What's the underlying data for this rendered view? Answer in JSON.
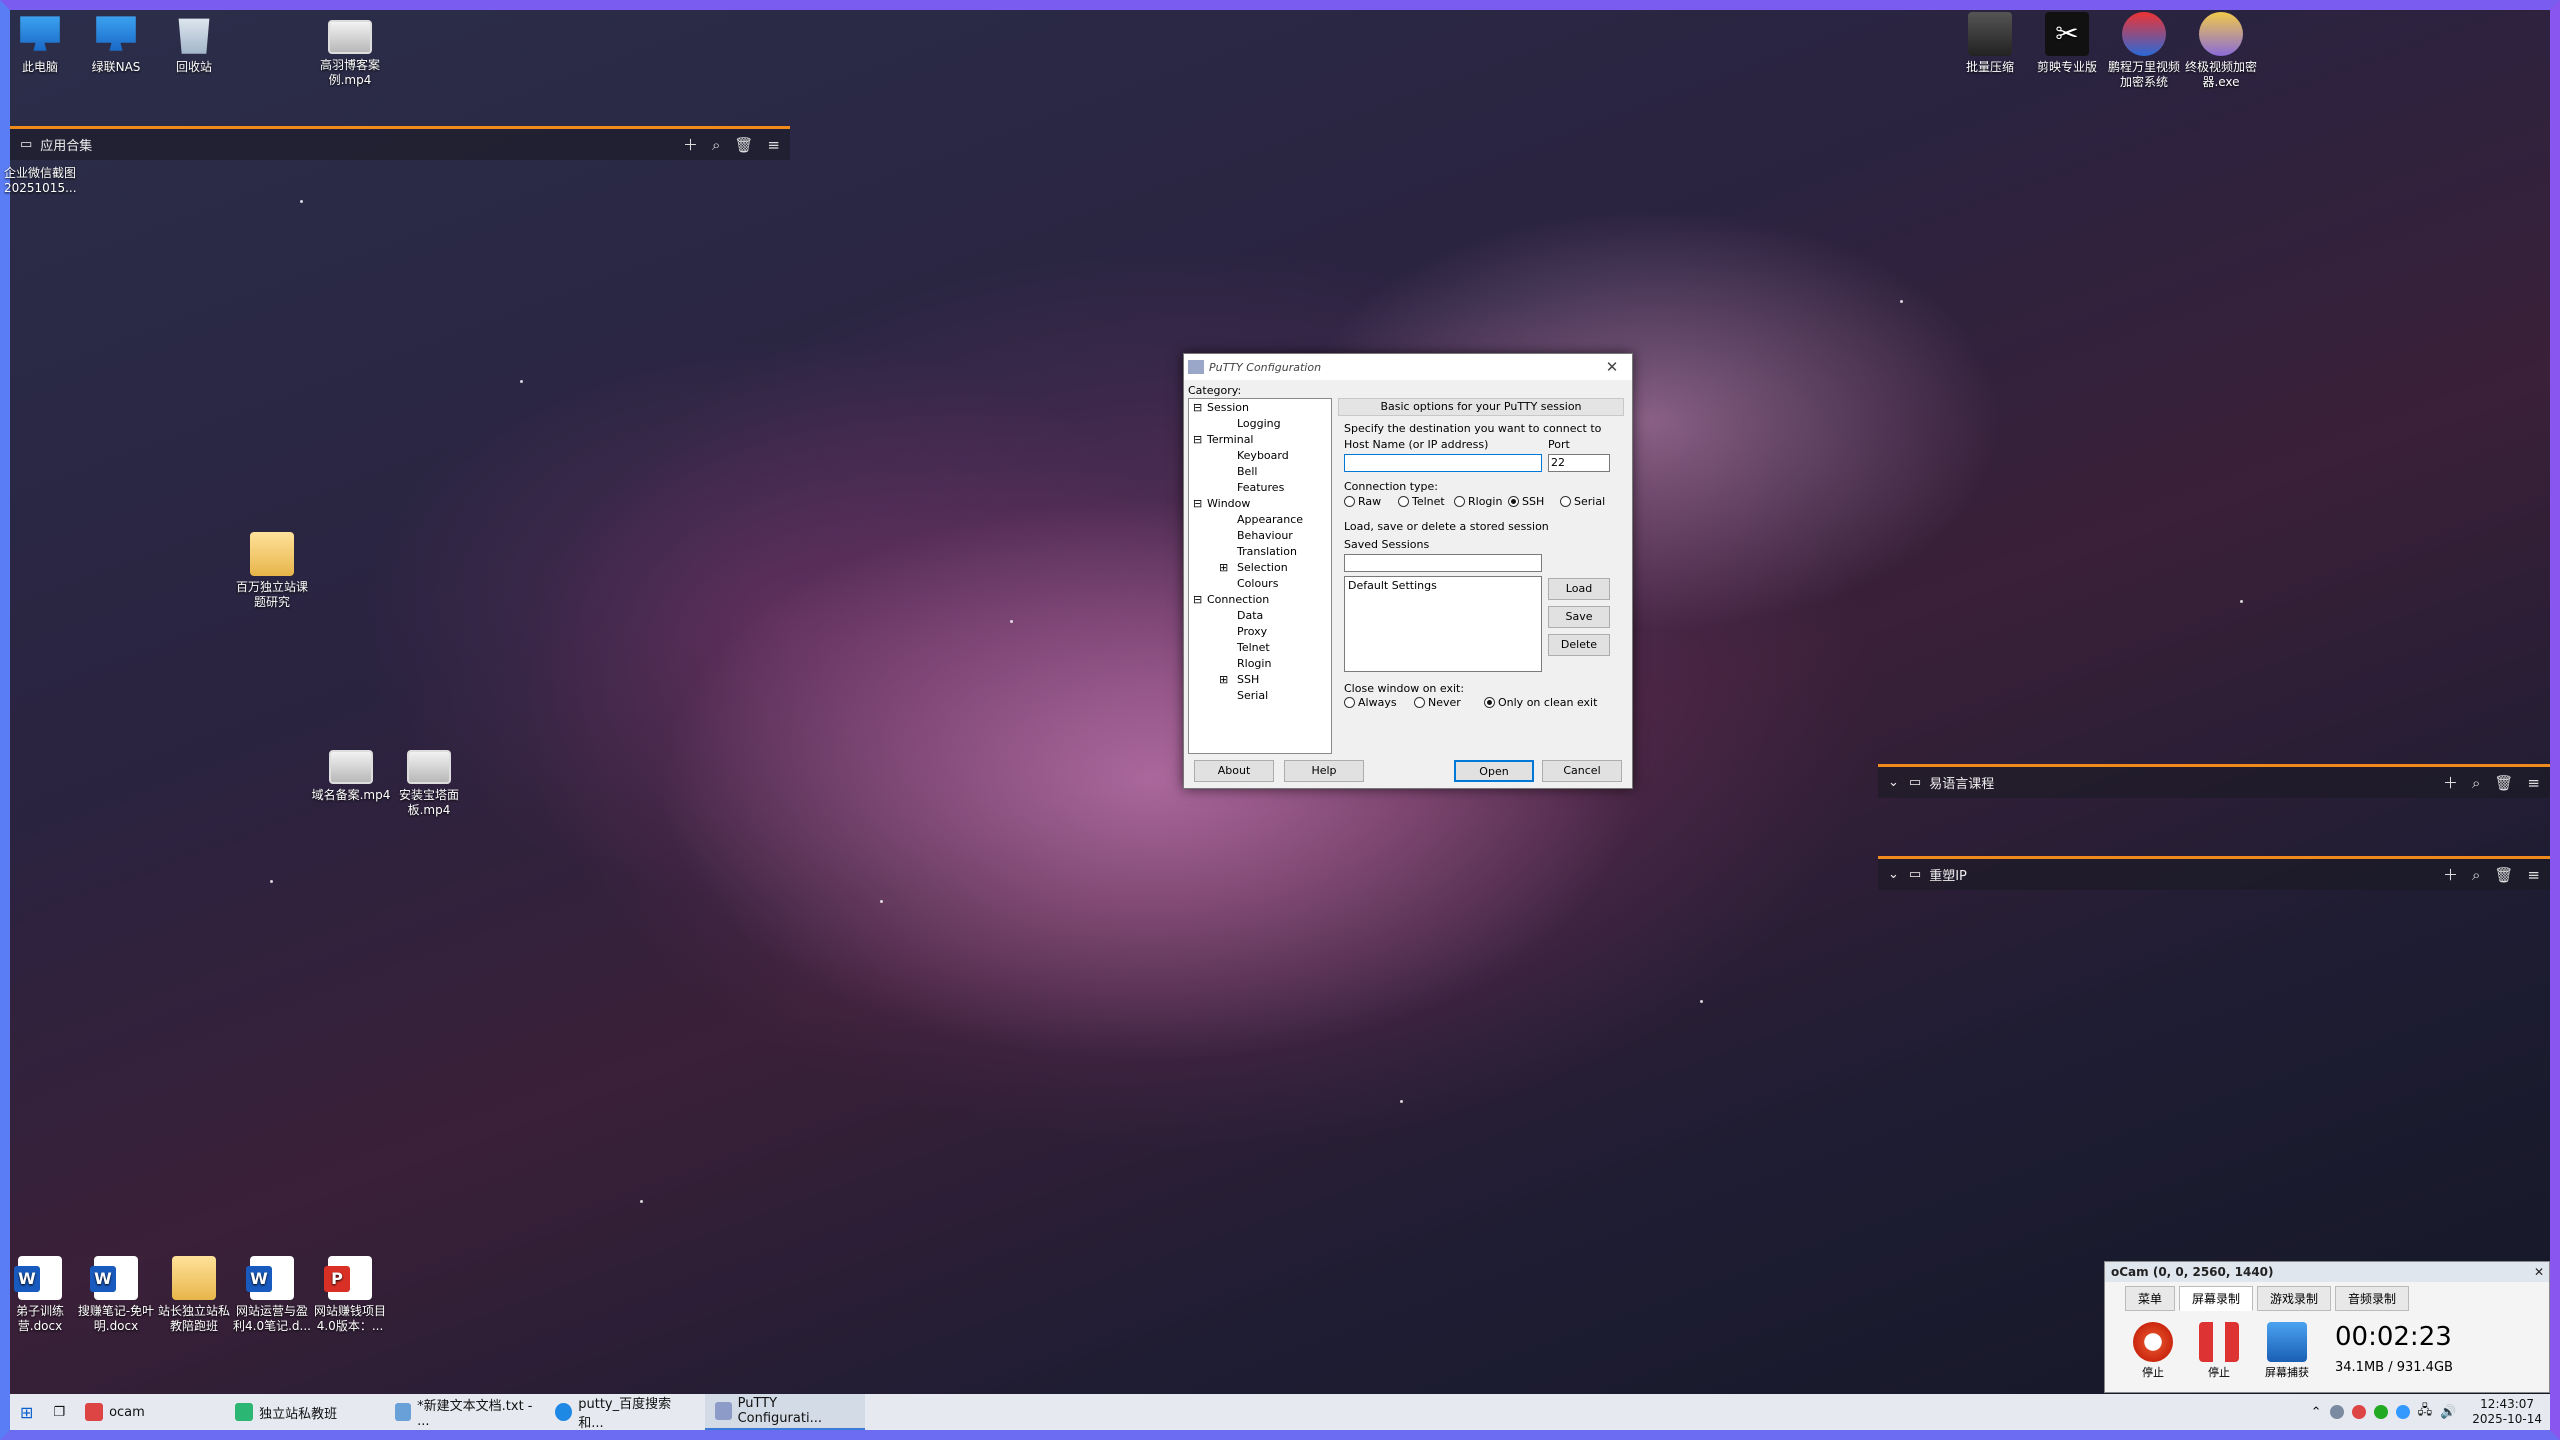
{
  "desktop_icons": {
    "this_pc": "此电脑",
    "nas": "绿联NAS",
    "recycle_bin": "回收站",
    "video_top": "高羽博客案例.mp4",
    "wechat_screenshot": "企业微信截图20251015...",
    "folder_research": "百万独立站课题研究",
    "video_domain": "域名备案.mp4",
    "video_baota": "安装宝塔面板.mp4",
    "doc_training": "弟子训练营.docx",
    "doc_notes": "搜赚笔记-免叶明.docx",
    "doc_folder": "站长独立站私教陪跑班",
    "doc_ops": "网站运营与盈利4.0笔记.d...",
    "doc_project": "网站赚钱项目4.0版本：...",
    "batch": "批量压缩",
    "capcut": "剪映专业版",
    "encrypt_sys": "鹏程万里视频加密系统",
    "encrypt_tool": "终极视频加密器.exe"
  },
  "fences": {
    "apps": "应用合集",
    "courses": "易语言课程",
    "ip": "重塑IP"
  },
  "putty": {
    "title": "PuTTY Configuration",
    "category_label": "Category:",
    "tree": {
      "session": "Session",
      "logging": "Logging",
      "terminal": "Terminal",
      "keyboard": "Keyboard",
      "bell": "Bell",
      "features": "Features",
      "window": "Window",
      "appearance": "Appearance",
      "behaviour": "Behaviour",
      "translation": "Translation",
      "selection": "Selection",
      "colours": "Colours",
      "connection": "Connection",
      "data": "Data",
      "proxy": "Proxy",
      "telnet": "Telnet",
      "rlogin": "Rlogin",
      "ssh": "SSH",
      "serial": "Serial"
    },
    "header": "Basic options for your PuTTY session",
    "dest_label": "Specify the destination you want to connect to",
    "host_label": "Host Name (or IP address)",
    "port_label": "Port",
    "host_value": "",
    "port_value": "22",
    "conn_type_label": "Connection type:",
    "conn_types": [
      "Raw",
      "Telnet",
      "Rlogin",
      "SSH",
      "Serial"
    ],
    "conn_selected": "SSH",
    "sessions_header": "Load, save or delete a stored session",
    "saved_sessions_label": "Saved Sessions",
    "saved_sessions_value": "",
    "session_list": [
      "Default Settings"
    ],
    "load": "Load",
    "save": "Save",
    "delete": "Delete",
    "close_label": "Close window on exit:",
    "close_options": [
      "Always",
      "Never",
      "Only on clean exit"
    ],
    "close_selected": "Only on clean exit",
    "about": "About",
    "help": "Help",
    "open": "Open",
    "cancel": "Cancel"
  },
  "ocam": {
    "title": "oCam (0, 0, 2560, 1440)",
    "tabs": [
      "菜单",
      "屏幕录制",
      "游戏录制",
      "音频录制"
    ],
    "active_tab": "屏幕录制",
    "stop1": "停止",
    "stop2": "停止",
    "capture": "屏幕捕获",
    "timer": "00:02:23",
    "size": "34.1MB / 931.4GB"
  },
  "taskbar": {
    "items": [
      {
        "label": "ocam"
      },
      {
        "label": "独立站私教班"
      },
      {
        "label": "*新建文本文档.txt - ..."
      },
      {
        "label": "putty_百度搜索 和..."
      },
      {
        "label": "PuTTY Configurati..."
      }
    ],
    "time": "12:43:07",
    "date": "2025-10-14"
  }
}
